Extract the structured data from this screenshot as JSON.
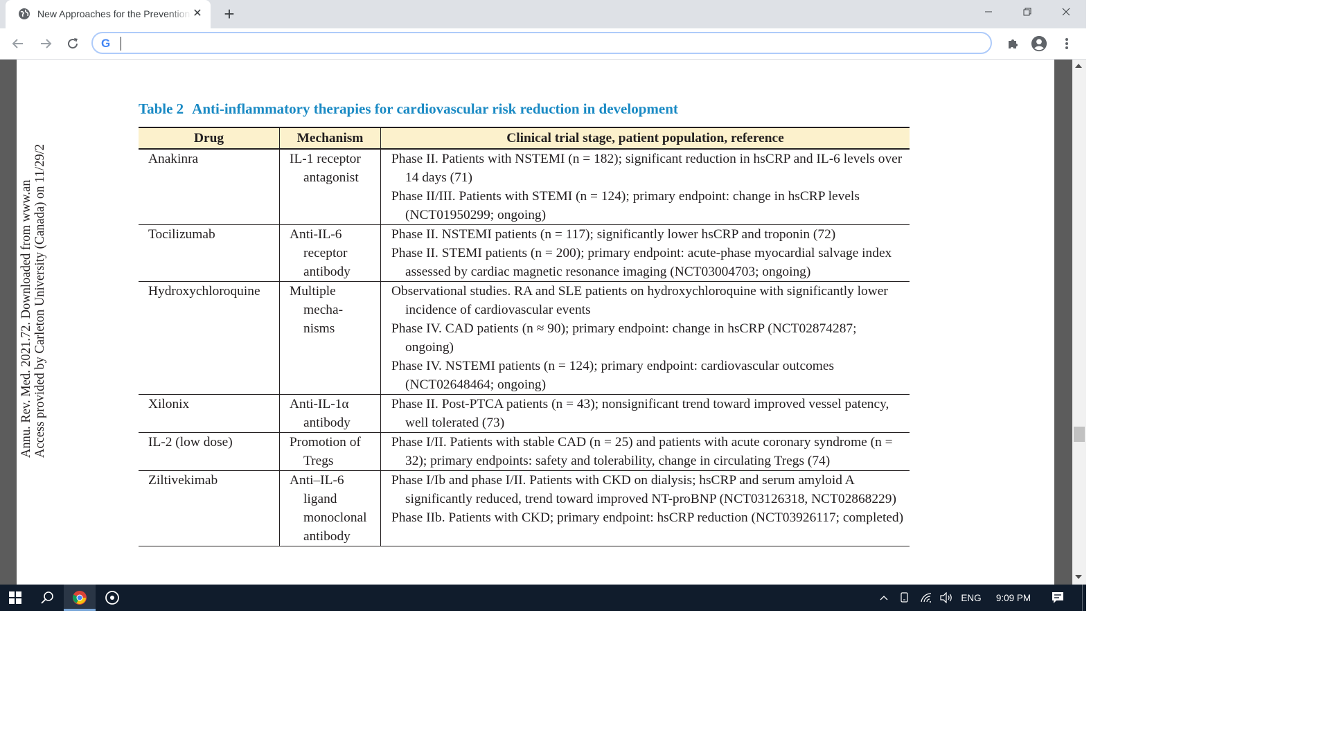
{
  "browser": {
    "tab_title": "New Approaches for the Prevention",
    "new_tab_symbol": "+",
    "close_symbol": "✕",
    "omnibox_value": "",
    "omnibox_placeholder": "",
    "omnibox_google_letter": "G"
  },
  "page": {
    "side_note_line1": "Annu. Rev. Med. 2021.72. Downloaded from www.an",
    "side_note_line2": "Access provided by Carleton University (Canada) on 11/29/2",
    "caption_number": "Table 2",
    "caption_title": "Anti-inflammatory therapies for cardiovascular risk reduction in development",
    "columns": [
      "Drug",
      "Mechanism",
      "Clinical trial stage, patient population, reference"
    ],
    "rows": [
      {
        "drug": "Anakinra",
        "mechanism": [
          "IL-1 receptor",
          "antagonist"
        ],
        "entries": [
          "Phase II. Patients with NSTEMI (n = 182); significant reduction in hsCRP and IL-6 levels over 14 days (71)",
          "Phase II/III. Patients with STEMI (n = 124); primary endpoint: change in hsCRP levels (NCT01950299; ongoing)"
        ]
      },
      {
        "drug": "Tocilizumab",
        "mechanism": [
          "Anti-IL-6",
          "receptor",
          "antibody"
        ],
        "entries": [
          "Phase II. NSTEMI patients (n = 117); significantly lower hsCRP and troponin (72)",
          "Phase II. STEMI patients (n = 200); primary endpoint: acute-phase myocardial salvage index assessed by cardiac magnetic resonance imaging (NCT03004703; ongoing)"
        ]
      },
      {
        "drug": "Hydroxychloroquine",
        "mechanism": [
          "Multiple",
          "mecha-",
          "nisms"
        ],
        "entries": [
          "Observational studies. RA and SLE patients on hydroxychloroquine with significantly lower incidence of cardiovascular events",
          "Phase IV. CAD patients (n ≈ 90); primary endpoint: change in hsCRP (NCT02874287; ongoing)",
          "Phase IV. NSTEMI patients (n = 124); primary endpoint: cardiovascular outcomes (NCT02648464; ongoing)"
        ]
      },
      {
        "drug": "Xilonix",
        "mechanism": [
          "Anti-IL-1α",
          "antibody"
        ],
        "entries": [
          "Phase II. Post-PTCA patients (n = 43); nonsignificant trend toward improved vessel patency, well tolerated (73)"
        ]
      },
      {
        "drug": "IL-2 (low dose)",
        "mechanism": [
          "Promotion of",
          "Tregs"
        ],
        "entries": [
          "Phase I/II. Patients with stable CAD (n = 25) and patients with acute coronary syndrome (n = 32); primary endpoints: safety and tolerability, change in circulating Tregs (74)"
        ]
      },
      {
        "drug": "Ziltivekimab",
        "mechanism": [
          "Anti–IL-6",
          "ligand",
          "monoclonal",
          "antibody"
        ],
        "entries": [
          "Phase I/Ib and phase I/II. Patients with CKD on dialysis; hsCRP and serum amyloid A significantly reduced, trend toward improved NT-proBNP (NCT03126318, NCT02868229)",
          "Phase IIb. Patients with CKD; primary endpoint: hsCRP reduction (NCT03926117; completed)"
        ]
      }
    ]
  },
  "taskbar": {
    "language": "ENG",
    "time": "9:09 PM"
  },
  "colors": {
    "caption_blue": "#1a8ac4",
    "header_fill": "#fcf1cc",
    "taskbar": "#101c2c"
  }
}
